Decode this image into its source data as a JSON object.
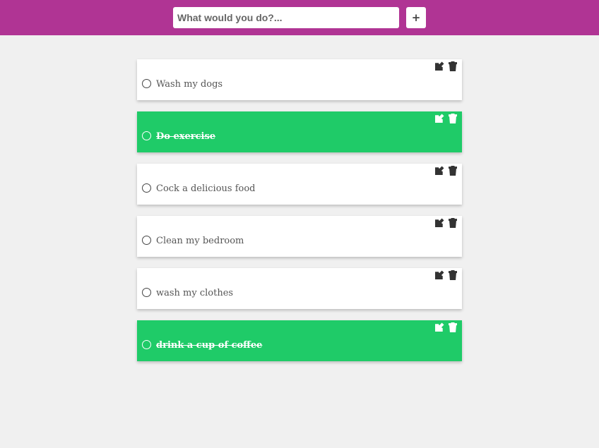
{
  "header": {
    "input_placeholder": "What would you do?...",
    "input_value": "",
    "add_button_icon": "plus-icon",
    "add_button_label": "+",
    "bar_color": "#b03494"
  },
  "colors": {
    "completed_item": "#1fcb68",
    "pending_item": "#ffffff",
    "page_background": "#f0f0f0"
  },
  "item_icons": {
    "toggle": "circle-outline-icon",
    "edit": "edit-icon",
    "delete": "trash-icon"
  },
  "tasks": [
    {
      "text": "Wash my dogs",
      "completed": false
    },
    {
      "text": "Do exercise",
      "completed": true
    },
    {
      "text": "Cock a delicious food",
      "completed": false
    },
    {
      "text": "Clean my bedroom",
      "completed": false
    },
    {
      "text": "wash my clothes",
      "completed": false
    },
    {
      "text": "drink a cup of coffee",
      "completed": true
    }
  ]
}
